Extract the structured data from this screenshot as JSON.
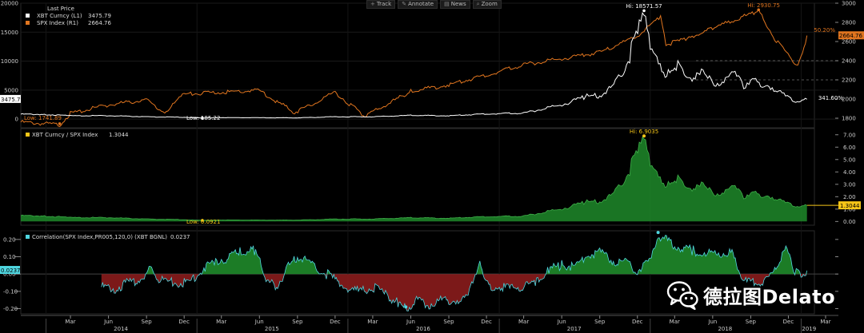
{
  "toolbar": [
    {
      "icon": "plus-icon",
      "glyph": "+",
      "label": "Track"
    },
    {
      "icon": "pencil-icon",
      "glyph": "✎",
      "label": "Annotate"
    },
    {
      "icon": "news-icon",
      "glyph": "▤",
      "label": "News"
    },
    {
      "icon": "zoom-icon",
      "glyph": "⌕",
      "label": "Zoom"
    }
  ],
  "watermark": {
    "text": "德拉图Delato",
    "icon": "wechat-icon"
  },
  "colors": {
    "xbt": "#ffffff",
    "spx": "#e0751f",
    "ratio_fill": "#1f8a2a",
    "corr_pos": "#1f8a2a",
    "corr_neg": "#8a1c1c",
    "corr_line": "#4fd6e0",
    "highlight": "#f5c518"
  },
  "x_axis": {
    "months": [
      "Mar",
      "Jun",
      "Sep",
      "Dec",
      "Mar",
      "Jun",
      "Sep",
      "Dec",
      "Mar",
      "Jun",
      "Sep",
      "Dec",
      "Mar",
      "Jun",
      "Sep",
      "Dec",
      "Mar",
      "Jun",
      "Sep",
      "Dec",
      "Mar"
    ],
    "years": [
      "2014",
      "2015",
      "2016",
      "2017",
      "2018",
      "2019"
    ]
  },
  "chart_data": [
    {
      "type": "line",
      "panel": "top",
      "legend_header": "Last Price",
      "legend_placement": "top-left",
      "series": [
        {
          "name": "XBT Curncy (L1)",
          "last": "3475.79",
          "axis": "left",
          "points": [
            [
              "2013-11-01",
              900
            ],
            [
              "2014-01-01",
              850
            ],
            [
              "2014-03-01",
              600
            ],
            [
              "2014-06-01",
              620
            ],
            [
              "2014-09-01",
              420
            ],
            [
              "2014-12-01",
              330
            ],
            [
              "2015-01-14",
              185.22
            ],
            [
              "2015-03-01",
              270
            ],
            [
              "2015-06-01",
              250
            ],
            [
              "2015-09-01",
              235
            ],
            [
              "2015-12-01",
              430
            ],
            [
              "2016-03-01",
              420
            ],
            [
              "2016-06-01",
              680
            ],
            [
              "2016-09-01",
              610
            ],
            [
              "2016-12-01",
              950
            ],
            [
              "2017-03-01",
              1100
            ],
            [
              "2017-06-01",
              2600
            ],
            [
              "2017-08-01",
              4200
            ],
            [
              "2017-09-01",
              4400
            ],
            [
              "2017-10-01",
              5800
            ],
            [
              "2017-11-01",
              9500
            ],
            [
              "2017-12-17",
              18571.57
            ],
            [
              "2018-01-01",
              14000
            ],
            [
              "2018-02-06",
              6900
            ],
            [
              "2018-03-01",
              10500
            ],
            [
              "2018-04-01",
              7000
            ],
            [
              "2018-05-01",
              9200
            ],
            [
              "2018-06-01",
              6400
            ],
            [
              "2018-07-25",
              8200
            ],
            [
              "2018-08-15",
              6300
            ],
            [
              "2018-09-01",
              7000
            ],
            [
              "2018-10-15",
              6400
            ],
            [
              "2018-11-20",
              4400
            ],
            [
              "2018-12-15",
              3300
            ],
            [
              "2019-01-15",
              3475.79
            ]
          ]
        },
        {
          "name": "SPX Index (R1)",
          "last": "2664.76",
          "axis": "right",
          "points": [
            [
              "2013-11-01",
              1770
            ],
            [
              "2014-02-03",
              1741.89
            ],
            [
              "2014-03-01",
              1860
            ],
            [
              "2014-06-01",
              1950
            ],
            [
              "2014-09-01",
              2000
            ],
            [
              "2014-10-15",
              1870
            ],
            [
              "2014-12-01",
              2060
            ],
            [
              "2015-03-01",
              2080
            ],
            [
              "2015-06-01",
              2100
            ],
            [
              "2015-08-25",
              1870
            ],
            [
              "2015-12-01",
              2080
            ],
            [
              "2016-02-11",
              1830
            ],
            [
              "2016-06-01",
              2090
            ],
            [
              "2016-09-01",
              2160
            ],
            [
              "2016-12-01",
              2260
            ],
            [
              "2017-03-01",
              2370
            ],
            [
              "2017-06-01",
              2430
            ],
            [
              "2017-09-01",
              2500
            ],
            [
              "2017-12-01",
              2670
            ],
            [
              "2018-01-26",
              2870
            ],
            [
              "2018-02-08",
              2580
            ],
            [
              "2018-04-01",
              2640
            ],
            [
              "2018-06-01",
              2750
            ],
            [
              "2018-09-20",
              2930.75
            ],
            [
              "2018-10-29",
              2640
            ],
            [
              "2018-12-24",
              2350
            ],
            [
              "2019-01-15",
              2664.76
            ]
          ]
        }
      ],
      "left_axis": {
        "ticks": [
          0,
          5000,
          10000,
          15000,
          20000
        ],
        "ylim": [
          -1500,
          20000
        ]
      },
      "right_axis": {
        "ticks": [
          1800,
          2000,
          2200,
          2400,
          2600,
          2800,
          3000
        ],
        "ylim": [
          1700,
          3000
        ]
      },
      "annotations": [
        {
          "text": "Hi: 18571.57",
          "x": "2017-12-17",
          "series": "XBT Curncy (L1)"
        },
        {
          "text": "Low: 185.22",
          "x": "2015-01-14",
          "series": "XBT Curncy (L1)"
        },
        {
          "text": "Hi: 2930.75",
          "x": "2018-09-20",
          "series": "SPX Index (R1)"
        },
        {
          "text": "Low: 1741.89",
          "x": "2014-02-03",
          "series": "SPX Index (R1)"
        },
        {
          "text": "50.20%",
          "x": "2019-01-15",
          "series": "SPX Index (R1)"
        },
        {
          "text": "341.60%",
          "x": "2019-01-15",
          "series": "XBT Curncy (L1)"
        }
      ],
      "last_labels": {
        "left": "3475.79",
        "right": "2664.76"
      }
    },
    {
      "type": "area",
      "panel": "middle",
      "legend_placement": "top-left",
      "series": [
        {
          "name": "XBT Curncy / SPX Index",
          "last": "1.3044",
          "points": [
            [
              "2013-11-01",
              0.5
            ],
            [
              "2014-01-01",
              0.48
            ],
            [
              "2014-03-01",
              0.33
            ],
            [
              "2014-06-01",
              0.33
            ],
            [
              "2014-09-01",
              0.21
            ],
            [
              "2014-12-01",
              0.16
            ],
            [
              "2015-01-14",
              0.0921
            ],
            [
              "2015-03-01",
              0.13
            ],
            [
              "2015-06-01",
              0.12
            ],
            [
              "2015-09-01",
              0.12
            ],
            [
              "2015-12-01",
              0.21
            ],
            [
              "2016-03-01",
              0.21
            ],
            [
              "2016-06-01",
              0.32
            ],
            [
              "2016-09-01",
              0.28
            ],
            [
              "2016-12-01",
              0.42
            ],
            [
              "2017-03-01",
              0.46
            ],
            [
              "2017-06-01",
              1.07
            ],
            [
              "2017-08-01",
              1.7
            ],
            [
              "2017-09-01",
              1.75
            ],
            [
              "2017-10-01",
              2.25
            ],
            [
              "2017-11-01",
              3.7
            ],
            [
              "2017-12-17",
              6.9035
            ],
            [
              "2018-01-01",
              5.2
            ],
            [
              "2018-02-06",
              2.65
            ],
            [
              "2018-03-01",
              3.9
            ],
            [
              "2018-04-01",
              2.65
            ],
            [
              "2018-05-01",
              3.4
            ],
            [
              "2018-06-01",
              2.35
            ],
            [
              "2018-07-25",
              2.9
            ],
            [
              "2018-08-15",
              2.2
            ],
            [
              "2018-09-01",
              2.4
            ],
            [
              "2018-10-15",
              2.3
            ],
            [
              "2018-11-20",
              1.65
            ],
            [
              "2018-12-15",
              1.35
            ],
            [
              "2019-01-15",
              1.3044
            ]
          ]
        }
      ],
      "right_axis": {
        "ticks": [
          0,
          1,
          2,
          3,
          4,
          5,
          6,
          7
        ],
        "tick_labels": [
          "0.00",
          "1.00",
          "2.00",
          "3.00",
          "4.00",
          "5.00",
          "6.00",
          "7.00"
        ],
        "ylim": [
          -0.3,
          7.5
        ]
      },
      "annotations": [
        {
          "text": "Hi: 6.9035",
          "x": "2017-12-17"
        },
        {
          "text": "Low: 0.0921",
          "x": "2015-01-14"
        }
      ],
      "last_label": "1.3044"
    },
    {
      "type": "area",
      "panel": "bottom",
      "legend_placement": "top-left",
      "series": [
        {
          "name": "Correlation(SPX Index,PR005,120,0) (XBT BGNL)",
          "last": "0.0237",
          "points": [
            [
              "2014-05-15",
              -0.06
            ],
            [
              "2014-06-15",
              -0.07
            ],
            [
              "2014-07-15",
              -0.04
            ],
            [
              "2014-08-15",
              -0.02
            ],
            [
              "2014-09-10",
              0.04
            ],
            [
              "2014-09-25",
              -0.01
            ],
            [
              "2014-10-20",
              -0.03
            ],
            [
              "2014-11-20",
              -0.04
            ],
            [
              "2014-12-15",
              -0.03
            ],
            [
              "2015-01-15",
              0.05
            ],
            [
              "2015-02-15",
              0.09
            ],
            [
              "2015-03-15",
              0.11
            ],
            [
              "2015-04-15",
              0.14
            ],
            [
              "2015-05-20",
              0.15
            ],
            [
              "2015-06-05",
              0.08
            ],
            [
              "2015-06-20",
              -0.04
            ],
            [
              "2015-07-15",
              -0.05
            ],
            [
              "2015-08-10",
              0.06
            ],
            [
              "2015-09-01",
              0.12
            ],
            [
              "2015-10-01",
              0.08
            ],
            [
              "2015-11-01",
              0.03
            ],
            [
              "2015-12-01",
              -0.02
            ],
            [
              "2016-01-01",
              -0.07
            ],
            [
              "2016-02-01",
              -0.09
            ],
            [
              "2016-03-01",
              -0.06
            ],
            [
              "2016-04-01",
              -0.1
            ],
            [
              "2016-05-01",
              -0.15
            ],
            [
              "2016-05-20",
              -0.19
            ],
            [
              "2016-06-15",
              -0.13
            ],
            [
              "2016-07-15",
              -0.16
            ],
            [
              "2016-08-15",
              -0.14
            ],
            [
              "2016-09-15",
              -0.13
            ],
            [
              "2016-10-15",
              -0.13
            ],
            [
              "2016-11-15",
              0.1
            ],
            [
              "2016-12-01",
              -0.05
            ],
            [
              "2017-01-01",
              -0.06
            ],
            [
              "2017-02-01",
              -0.07
            ],
            [
              "2017-03-01",
              -0.05
            ],
            [
              "2017-04-01",
              -0.03
            ],
            [
              "2017-05-01",
              0.04
            ],
            [
              "2017-06-01",
              0.07
            ],
            [
              "2017-07-01",
              0.06
            ],
            [
              "2017-08-01",
              0.12
            ],
            [
              "2017-09-01",
              0.14
            ],
            [
              "2017-10-01",
              0.09
            ],
            [
              "2017-11-01",
              0.08
            ],
            [
              "2017-12-01",
              0.04
            ],
            [
              "2018-01-01",
              0.08
            ],
            [
              "2018-01-20",
              0.24
            ],
            [
              "2018-02-15",
              0.2
            ],
            [
              "2018-03-15",
              0.17
            ],
            [
              "2018-04-15",
              0.15
            ],
            [
              "2018-05-15",
              0.14
            ],
            [
              "2018-06-15",
              0.13
            ],
            [
              "2018-07-15",
              0.15
            ],
            [
              "2018-07-31",
              0.05
            ],
            [
              "2018-08-20",
              -0.03
            ],
            [
              "2018-09-15",
              -0.04
            ],
            [
              "2018-10-15",
              -0.02
            ],
            [
              "2018-11-01",
              0.05
            ],
            [
              "2018-11-25",
              0.15
            ],
            [
              "2018-12-10",
              0.08
            ],
            [
              "2018-12-20",
              0.02
            ],
            [
              "2019-01-15",
              0.0237
            ]
          ]
        }
      ],
      "right_axis": {
        "ticks": [
          -0.2,
          -0.1,
          0,
          0.1,
          0.2
        ],
        "tick_labels": [
          "-0.20",
          "-0.10",
          "0.00",
          "0.10",
          "0.20"
        ],
        "ylim": [
          -0.23,
          0.25
        ]
      },
      "last_label": "0.0237"
    }
  ]
}
